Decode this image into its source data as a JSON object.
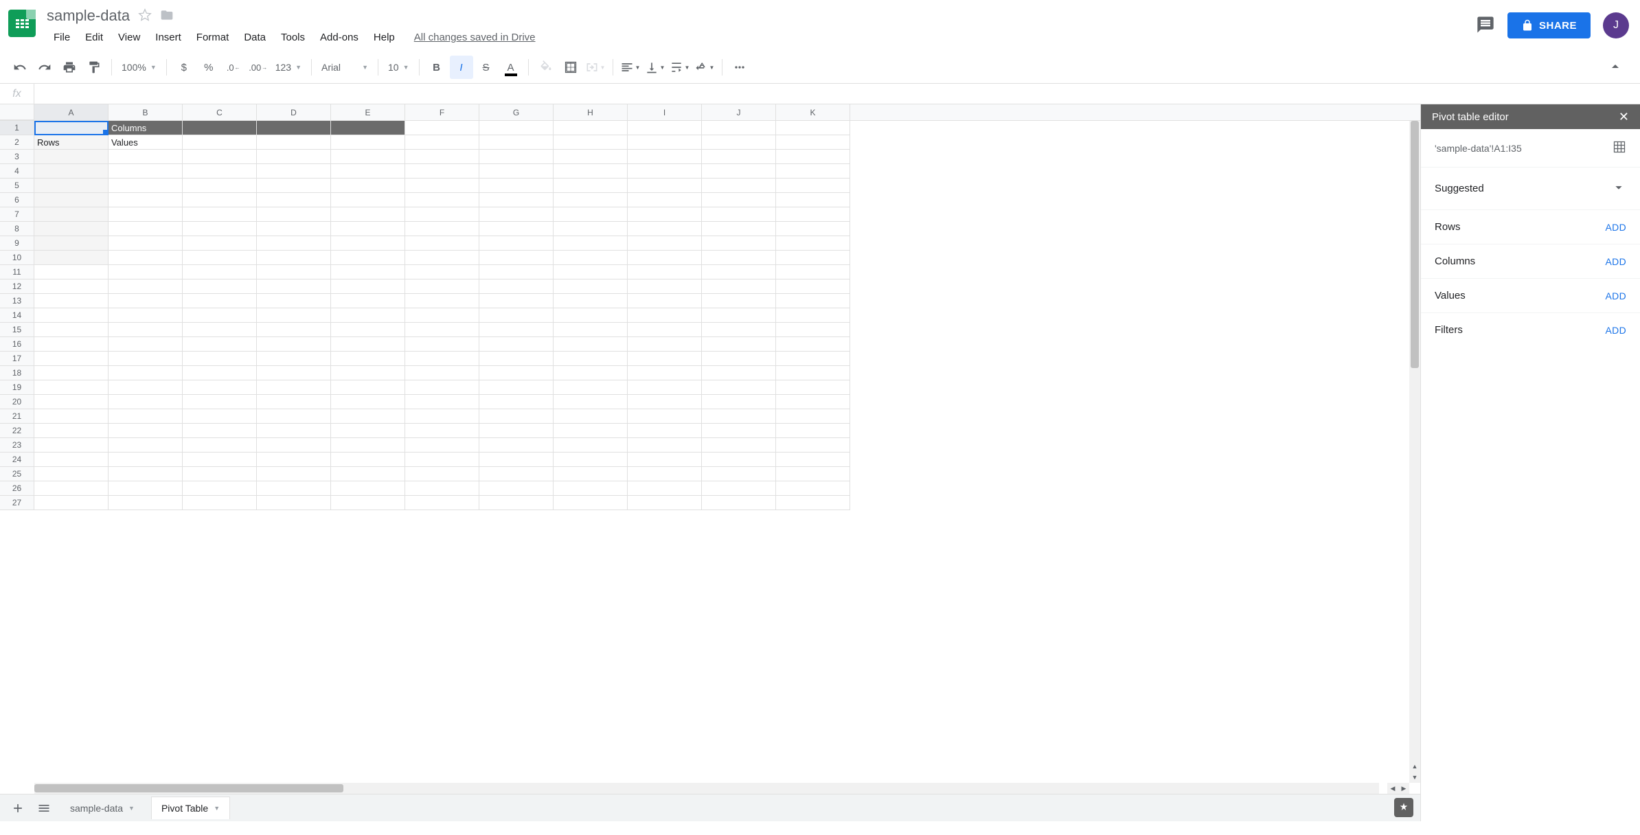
{
  "doc": {
    "title": "sample-data",
    "save_status": "All changes saved in Drive"
  },
  "menus": [
    "File",
    "Edit",
    "View",
    "Insert",
    "Format",
    "Data",
    "Tools",
    "Add-ons",
    "Help"
  ],
  "share": {
    "label": "SHARE"
  },
  "avatar": {
    "initial": "J"
  },
  "toolbar": {
    "zoom": "100%",
    "format123": "123",
    "font": "Arial",
    "size": "10",
    "currency": "$",
    "percent": "%",
    "dec_less": ".0",
    "dec_more": ".00"
  },
  "formula": {
    "fx": "fx",
    "value": ""
  },
  "columns": [
    "A",
    "B",
    "C",
    "D",
    "E",
    "F",
    "G",
    "H",
    "I",
    "J",
    "K"
  ],
  "rows": [
    "1",
    "2",
    "3",
    "4",
    "5",
    "6",
    "7",
    "8",
    "9",
    "10",
    "11",
    "12",
    "13",
    "14",
    "15",
    "16",
    "17",
    "18",
    "19",
    "20",
    "21",
    "22",
    "23",
    "24",
    "25",
    "26",
    "27"
  ],
  "pivot_cells": {
    "b1": "Columns",
    "a2": "Rows",
    "b2": "Values"
  },
  "selected_col": "A",
  "selected_row": "1",
  "sheet_tabs": {
    "tab1": "sample-data",
    "tab2": "Pivot Table"
  },
  "pivot_editor": {
    "title": "Pivot table editor",
    "source": "'sample-data'!A1:I35",
    "suggested": "Suggested",
    "rows": "Rows",
    "columns": "Columns",
    "values": "Values",
    "filters": "Filters",
    "add": "ADD"
  }
}
